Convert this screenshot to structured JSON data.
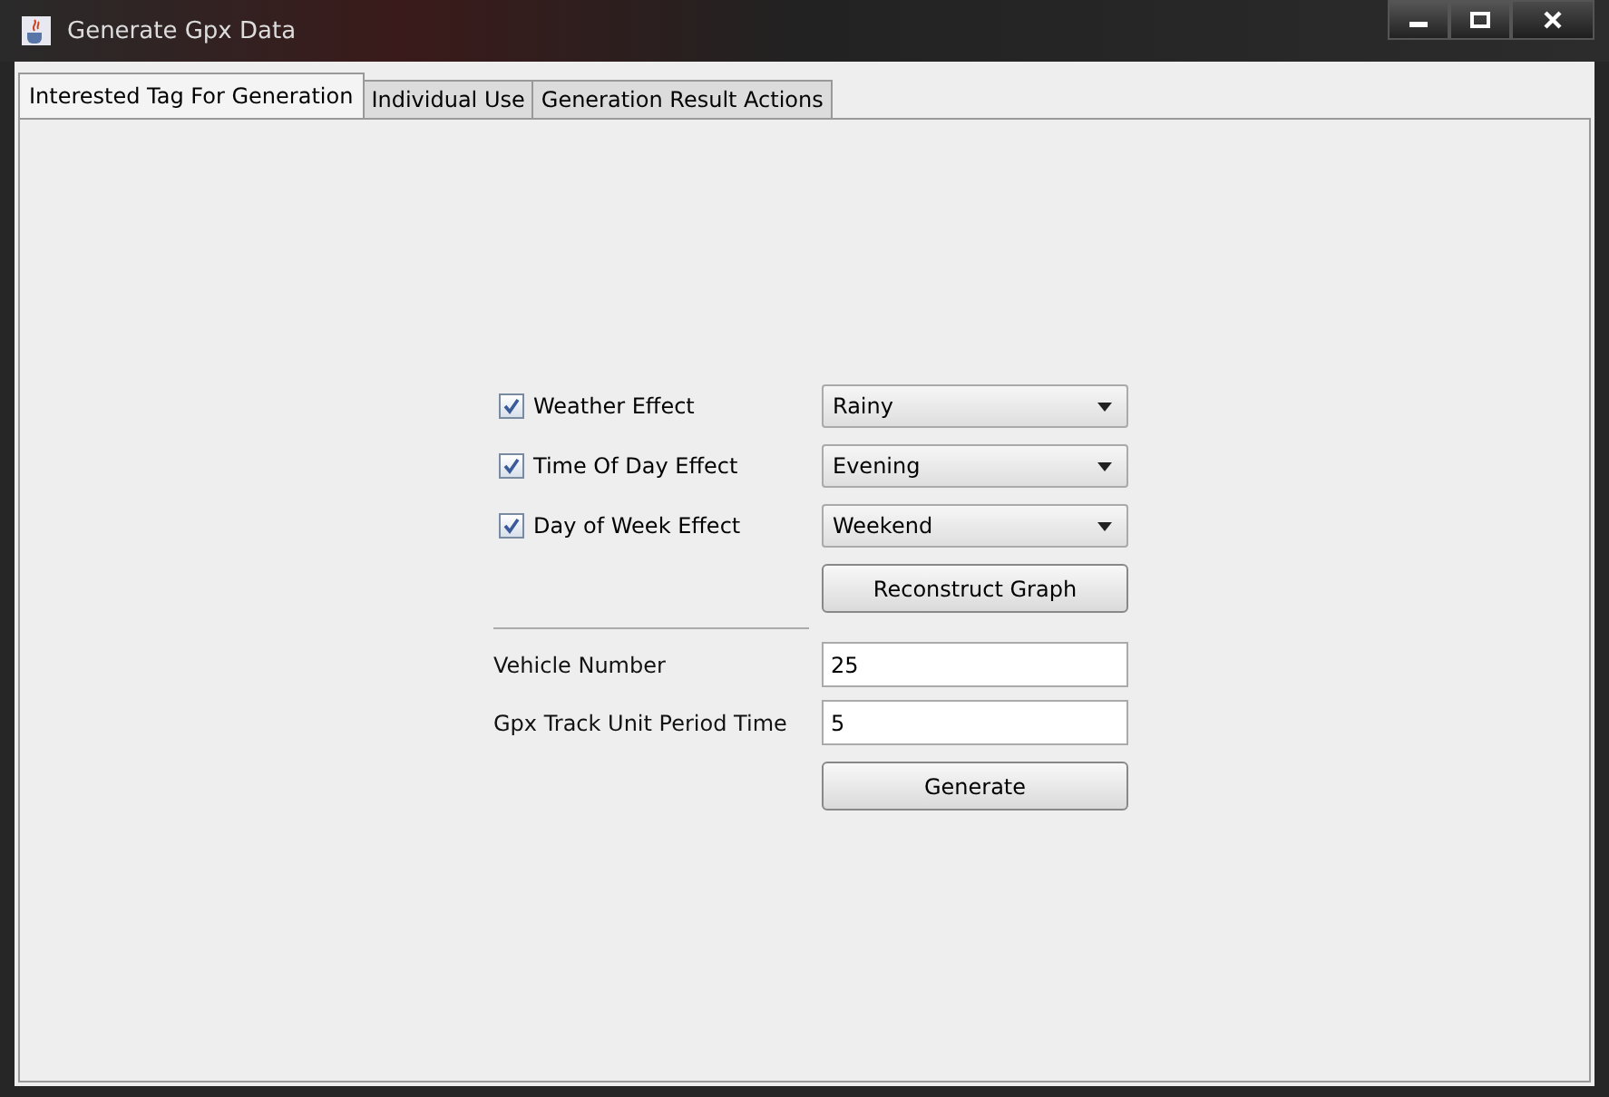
{
  "window": {
    "title": "Generate Gpx Data"
  },
  "tabs": [
    {
      "label": "Interested Tag For Generation",
      "selected": true
    },
    {
      "label": "Individual Use",
      "selected": false
    },
    {
      "label": "Generation Result Actions",
      "selected": false
    }
  ],
  "effects": [
    {
      "label": "Weather Effect",
      "checked": true,
      "value": "Rainy"
    },
    {
      "label": "Time Of Day Effect",
      "checked": true,
      "value": "Evening"
    },
    {
      "label": "Day of Week Effect",
      "checked": true,
      "value": "Weekend"
    }
  ],
  "reconstruct_button": "Reconstruct Graph",
  "fields": [
    {
      "label": "Vehicle Number",
      "value": "25"
    },
    {
      "label": "Gpx Track Unit Period Time",
      "value": "5"
    }
  ],
  "generate_button": "Generate"
}
